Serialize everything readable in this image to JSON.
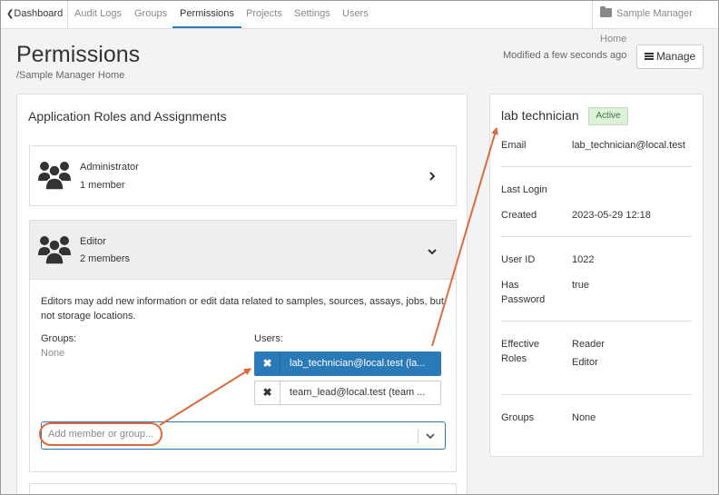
{
  "nav": {
    "items": [
      {
        "label": "Dashboard"
      },
      {
        "label": "Audit Logs"
      },
      {
        "label": "Groups"
      },
      {
        "label": "Permissions"
      },
      {
        "label": "Projects"
      },
      {
        "label": "Settings"
      },
      {
        "label": "Users"
      }
    ],
    "home_label": "Sample Manager Home"
  },
  "header": {
    "title": "Permissions",
    "breadcrumb": "/Sample Manager Home",
    "modified": "Modified a few seconds ago",
    "manage_label": "Manage"
  },
  "roles_panel": {
    "title": "Application Roles and Assignments",
    "roles": [
      {
        "name": "Administrator",
        "count": "1 member",
        "expanded": false
      },
      {
        "name": "Editor",
        "count": "2 members",
        "expanded": true
      }
    ],
    "editor": {
      "description": "Editors may add new information or edit data related to samples, sources, assays, jobs, but not storage locations.",
      "groups_label": "Groups:",
      "groups_value": "None",
      "users_label": "Users:",
      "users": [
        {
          "label": "lab_technician@local.test (la...",
          "selected": true
        },
        {
          "label": "team_lead@local.test (team ...",
          "selected": false
        }
      ],
      "add_placeholder": "Add member or group..."
    }
  },
  "user_panel": {
    "name": "lab technician",
    "status": "Active",
    "email_label": "Email",
    "email": "lab_technician@local.test",
    "last_login_label": "Last Login",
    "created_label": "Created",
    "created": "2023-05-29 12:18",
    "user_id_label": "User ID",
    "user_id": "1022",
    "has_password_label_1": "Has",
    "has_password_label_2": "Password",
    "has_password": "true",
    "effective_roles_label_1": "Effective",
    "effective_roles_label_2": "Roles",
    "effective_roles": [
      "Reader",
      "Editor"
    ],
    "groups_label": "Groups",
    "groups": "None"
  },
  "colors": {
    "accent": "#2a7ab8",
    "annotation": "#e0693a",
    "active_badge_bg": "#dff0d8"
  }
}
